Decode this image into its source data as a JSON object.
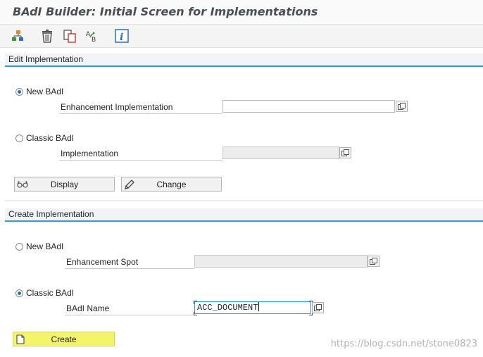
{
  "title": "BAdI Builder: Initial Screen for Implementations",
  "toolbar": {
    "buttons": [
      {
        "name": "hierarchy-icon"
      },
      {
        "name": "delete-icon"
      },
      {
        "name": "copy-icon"
      },
      {
        "name": "rename-icon",
        "text": "A B"
      },
      {
        "name": "info-icon",
        "text": "i"
      }
    ]
  },
  "edit_group": {
    "title": "Edit Implementation",
    "new_badi": {
      "label": "New BAdI",
      "selected": true
    },
    "enh_impl": {
      "label": "Enhancement Implementation",
      "value": ""
    },
    "classic_badi": {
      "label": "Classic BAdI",
      "selected": false
    },
    "implementation": {
      "label": "Implementation",
      "value": ""
    },
    "display_button": "Display",
    "change_button": "Change"
  },
  "create_group": {
    "title": "Create Implementation",
    "new_badi": {
      "label": "New BAdI",
      "selected": false
    },
    "enh_spot": {
      "label": "Enhancement Spot",
      "value": ""
    },
    "classic_badi": {
      "label": "Classic BAdI",
      "selected": true
    },
    "badi_name": {
      "label": "BAdI Name",
      "value": "ACC_DOCUMENT"
    },
    "create_button": "Create"
  },
  "watermark": "https://blog.csdn.net/stone0823",
  "colors": {
    "accent_line": "#2f9bd6",
    "create_highlight": "#f4f46a",
    "radio_dot": "#2f6db3"
  }
}
